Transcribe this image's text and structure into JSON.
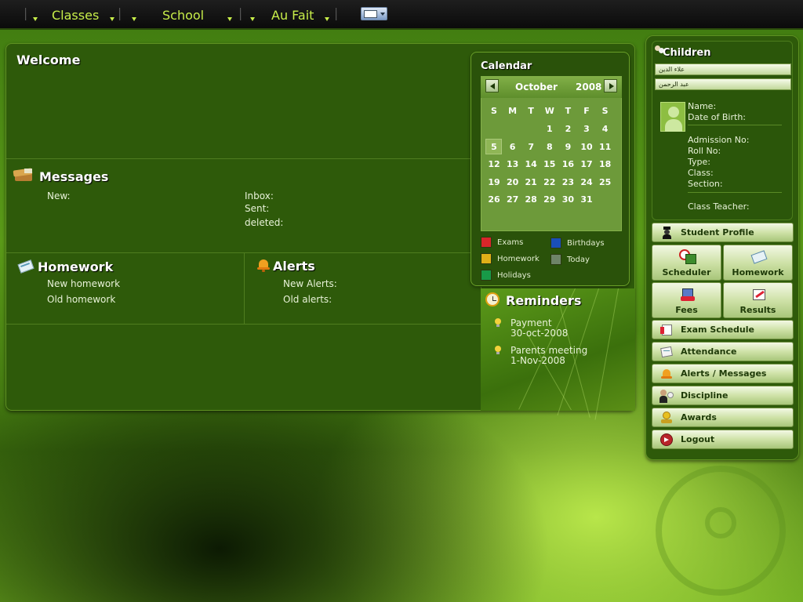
{
  "topbar": {
    "menus": [
      "Classes",
      "School",
      "Au Fait"
    ]
  },
  "welcome": {
    "title": "Welcome"
  },
  "messages": {
    "title": "Messages",
    "new_label": "New:",
    "inbox_label": "Inbox:",
    "sent_label": "Sent:",
    "deleted_label": "deleted:"
  },
  "homework": {
    "title": "Homework",
    "new_label": "New homework",
    "old_label": "Old homework"
  },
  "alerts": {
    "title": "Alerts",
    "new_label": "New Alerts:",
    "old_label": "Old alerts:"
  },
  "calendar": {
    "title": "Calendar",
    "month": "October",
    "year": "2008",
    "weekdays": [
      "S",
      "M",
      "T",
      "W",
      "T",
      "F",
      "S"
    ],
    "weeks": [
      [
        "",
        "",
        "",
        "1",
        "2",
        "3",
        "4"
      ],
      [
        "5",
        "6",
        "7",
        "8",
        "9",
        "10",
        "11"
      ],
      [
        "12",
        "13",
        "14",
        "15",
        "16",
        "17",
        "18"
      ],
      [
        "19",
        "20",
        "21",
        "22",
        "23",
        "24",
        "25"
      ],
      [
        "26",
        "27",
        "28",
        "29",
        "30",
        "31",
        ""
      ]
    ],
    "today": "5",
    "legend": [
      {
        "label": "Exams",
        "color": "#d8262a"
      },
      {
        "label": "Birthdays",
        "color": "#1a4fb8"
      },
      {
        "label": "Homework",
        "color": "#e0b018"
      },
      {
        "label": "Today",
        "color": "#6e8468"
      },
      {
        "label": "Holidays",
        "color": "#189a48"
      }
    ]
  },
  "reminders": {
    "title": "Reminders",
    "items": [
      {
        "title": "Payment",
        "date": "30-oct-2008"
      },
      {
        "title": "Parents meeting",
        "date": "1-Nov-2008"
      }
    ]
  },
  "children": {
    "title": "Children",
    "list": [
      "علاء الدين",
      "عبد الرحمن"
    ],
    "labels": {
      "name": "Name:",
      "dob": "Date of Birth:",
      "admission": "Admission No:",
      "roll": "Roll No:",
      "type": "Type:",
      "class": "Class:",
      "section": "Section:",
      "teacher": "Class Teacher:"
    }
  },
  "nav": {
    "student_profile": "Student Profile",
    "scheduler": "Scheduler",
    "homework": "Homework",
    "fees": "Fees",
    "results": "Results",
    "exam_schedule": "Exam Schedule",
    "attendance": "Attendance",
    "alerts_messages": "Alerts / Messages",
    "discipline": "Discipline",
    "awards": "Awards",
    "logout": "Logout"
  }
}
